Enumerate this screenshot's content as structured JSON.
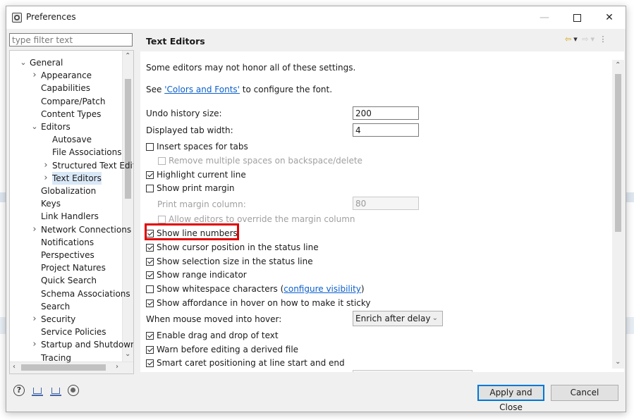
{
  "window": {
    "title": "Preferences"
  },
  "filter": {
    "placeholder": "type filter text"
  },
  "tree": [
    {
      "label": "General",
      "arrow": "⌄"
    },
    {
      "label": "Appearance",
      "arrow": "›"
    },
    {
      "label": "Capabilities",
      "arrow": ""
    },
    {
      "label": "Compare/Patch",
      "arrow": ""
    },
    {
      "label": "Content Types",
      "arrow": ""
    },
    {
      "label": "Editors",
      "arrow": "⌄"
    },
    {
      "label": "Autosave",
      "arrow": ""
    },
    {
      "label": "File Associations",
      "arrow": ""
    },
    {
      "label": "Structured Text Edit",
      "arrow": "›"
    },
    {
      "label": "Text Editors",
      "arrow": "›",
      "selected": true
    },
    {
      "label": "Globalization",
      "arrow": ""
    },
    {
      "label": "Keys",
      "arrow": ""
    },
    {
      "label": "Link Handlers",
      "arrow": ""
    },
    {
      "label": "Network Connections",
      "arrow": "›"
    },
    {
      "label": "Notifications",
      "arrow": ""
    },
    {
      "label": "Perspectives",
      "arrow": ""
    },
    {
      "label": "Project Natures",
      "arrow": ""
    },
    {
      "label": "Quick Search",
      "arrow": ""
    },
    {
      "label": "Schema Associations",
      "arrow": ""
    },
    {
      "label": "Search",
      "arrow": ""
    },
    {
      "label": "Security",
      "arrow": "›"
    },
    {
      "label": "Service Policies",
      "arrow": ""
    },
    {
      "label": "Startup and Shutdown",
      "arrow": "›"
    },
    {
      "label": "Tracing",
      "arrow": ""
    }
  ],
  "page": {
    "title": "Text Editors",
    "note": "Some editors may not honor all of these settings.",
    "see_prefix": "See ",
    "see_link": "'Colors and Fonts'",
    "see_suffix": " to configure the font.",
    "undo_label": "Undo history size:",
    "undo_value": "200",
    "tab_width_label": "Displayed tab width:",
    "tab_width_value": "4",
    "insert_spaces": "Insert spaces for tabs",
    "remove_spaces": "Remove multiple spaces on backspace/delete",
    "highlight_line": "Highlight current line",
    "show_print_margin": "Show print margin",
    "print_margin_column_label": "Print margin column:",
    "print_margin_column_value": "80",
    "allow_override": "Allow editors to override the margin column",
    "show_line_numbers": "Show line numbers",
    "show_cursor_pos": "Show cursor position in the status line",
    "show_selection_size": "Show selection size in the status line",
    "show_range": "Show range indicator",
    "show_whitespace_prefix": "Show whitespace characters (",
    "show_whitespace_link": "configure visibility",
    "show_whitespace_suffix": ")",
    "show_affordance": "Show affordance in hover on how to make it sticky",
    "hover_label": "When mouse moved into hover:",
    "hover_value": "Enrich after delay",
    "enable_drag": "Enable drag and drop of text",
    "warn_derived": "Warn before editing a derived file",
    "smart_caret": "Smart caret positioning at line start and end"
  },
  "buttons": {
    "apply_close": "Apply and Close",
    "cancel": "Cancel"
  },
  "colors": {
    "highlight": "#e00000",
    "link": "#0b5fcc",
    "default_button_border": "#0078d7"
  }
}
